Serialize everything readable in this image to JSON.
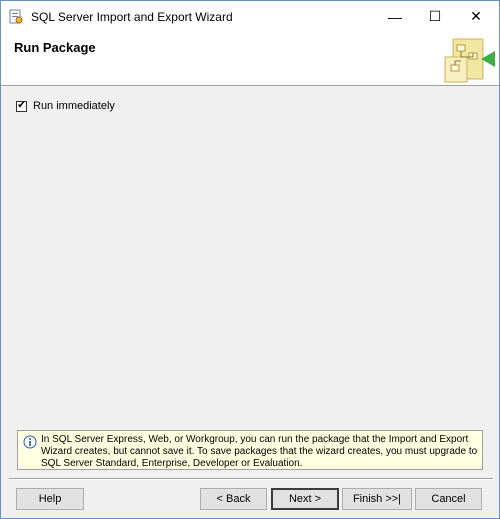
{
  "window": {
    "title": "SQL Server Import and Export Wizard",
    "minimize_glyph": "—",
    "maximize_glyph": "☐",
    "close_glyph": "✕"
  },
  "header": {
    "page_title": "Run Package",
    "art_icon": "wizard-header-icon"
  },
  "options": {
    "run_immediately": {
      "label": "Run immediately",
      "checked": true,
      "check_glyph": "✔"
    }
  },
  "info": {
    "icon": "info-icon",
    "text": "In SQL Server Express, Web, or Workgroup, you can run the package that the Import and Export Wizard creates, but cannot save it. To save packages that the wizard creates, you must upgrade to SQL Server Standard, Enterprise, Developer or Evaluation."
  },
  "buttons": {
    "help": "Help",
    "back": "< Back",
    "next": "Next >",
    "finish": "Finish >>|",
    "cancel": "Cancel"
  },
  "colors": {
    "info_background": "#ffffe1",
    "dialog_background": "#f0f0f0"
  }
}
